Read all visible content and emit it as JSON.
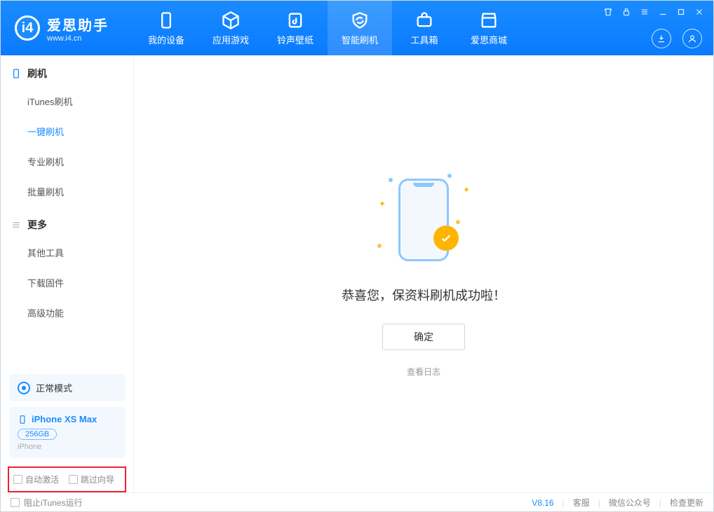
{
  "logo": {
    "cn": "爱思助手",
    "url": "www.i4.cn"
  },
  "tabs": [
    {
      "label": "我的设备"
    },
    {
      "label": "应用游戏"
    },
    {
      "label": "铃声壁纸"
    },
    {
      "label": "智能刷机"
    },
    {
      "label": "工具箱"
    },
    {
      "label": "爱思商城"
    }
  ],
  "sidebar": {
    "group1": "刷机",
    "items1": [
      "iTunes刷机",
      "一键刷机",
      "专业刷机",
      "批量刷机"
    ],
    "group2": "更多",
    "items2": [
      "其他工具",
      "下载固件",
      "高级功能"
    ]
  },
  "mode_label": "正常模式",
  "device": {
    "name": "iPhone XS Max",
    "capacity": "256GB",
    "sub": "iPhone"
  },
  "options": {
    "auto_activate": "自动激活",
    "skip_guide": "跳过向导"
  },
  "main": {
    "success": "恭喜您，保资料刷机成功啦！",
    "ok": "确定",
    "view_log": "查看日志"
  },
  "footer": {
    "block_itunes": "阻止iTunes运行",
    "version": "V8.16",
    "support": "客服",
    "wechat": "微信公众号",
    "check_update": "检查更新"
  }
}
